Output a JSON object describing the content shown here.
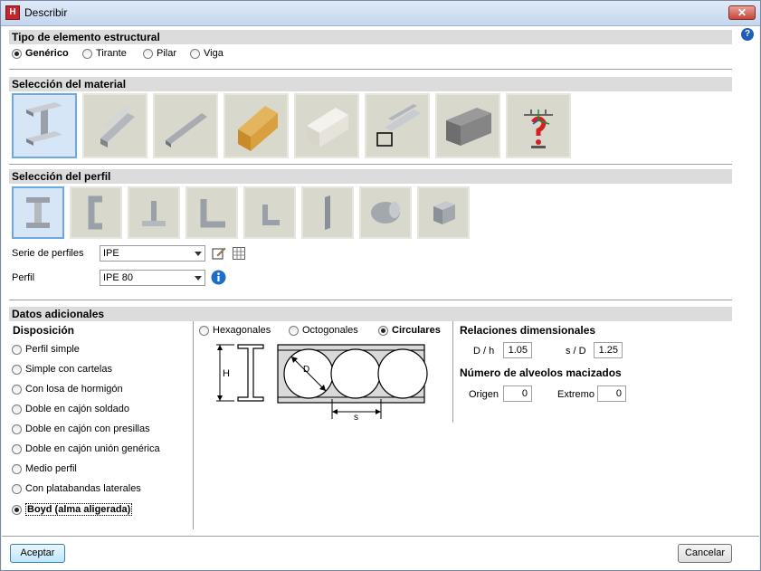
{
  "window": {
    "title": "Describir",
    "close": "✕",
    "help": "?"
  },
  "tipo": {
    "heading": "Tipo de elemento estructural",
    "options": [
      "Genérico",
      "Tirante",
      "Pilar",
      "Viga"
    ],
    "selected": "Genérico"
  },
  "material": {
    "heading": "Selección del material",
    "tiles": [
      "steel-i-beam",
      "cold-formed-steel",
      "aluminum-profile",
      "timber-beam",
      "generic-material",
      "composite-steel",
      "concrete-beam",
      "generic-user-defined"
    ],
    "selected": "steel-i-beam"
  },
  "perfil": {
    "heading": "Selección del perfil",
    "tiles": [
      "i-section",
      "channel-section",
      "t-section",
      "angle-section",
      "small-angle-section",
      "flat-bar-section",
      "round-bar-section",
      "square-bar-section"
    ],
    "selected": "i-section",
    "serie_label": "Serie de perfiles",
    "serie_value": "IPE",
    "perfil_label": "Perfil",
    "perfil_value": "IPE 80"
  },
  "datos": {
    "heading": "Datos adicionales",
    "disposicion_heading": "Disposición",
    "disposicion": [
      "Perfil simple",
      "Simple con cartelas",
      "Con losa de hormigón",
      "Doble en cajón soldado",
      "Doble en cajón con presillas",
      "Doble en cajón unión genérica",
      "Medio perfil",
      "Con platabandas laterales",
      "Boyd (alma aligerada)"
    ],
    "disposicion_selected": "Boyd (alma aligerada)",
    "alveolo_tipo": [
      "Hexagonales",
      "Octogonales",
      "Circulares"
    ],
    "alveolo_selected": "Circulares",
    "drawing": {
      "h": "H",
      "d": "D",
      "s": "s"
    },
    "relaciones_heading": "Relaciones dimensionales",
    "dh_label": "D / h",
    "dh_value": "1.05",
    "sd_label": "s / D",
    "sd_value": "1.25",
    "alveolos_heading": "Número de alveolos macizados",
    "origen_label": "Origen",
    "origen_value": "0",
    "extremo_label": "Extremo",
    "extremo_value": "0"
  },
  "buttons": {
    "accept": "Aceptar",
    "cancel": "Cancelar"
  }
}
